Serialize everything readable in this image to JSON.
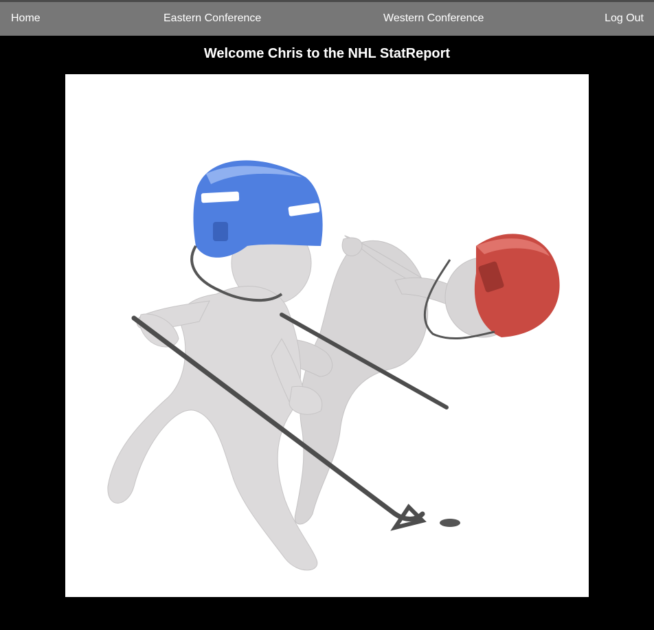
{
  "nav": {
    "home": "Home",
    "eastern": "Eastern Conference",
    "western": "Western Conference",
    "logout": "Log Out"
  },
  "main": {
    "title": "Welcome Chris to the NHL StatReport"
  },
  "hero_image": {
    "depicts": "hockey-players-illustration",
    "helmet_left_color": "#4f7fe0",
    "helmet_right_color": "#c94a42",
    "figure_color": "#d9d7d8"
  }
}
